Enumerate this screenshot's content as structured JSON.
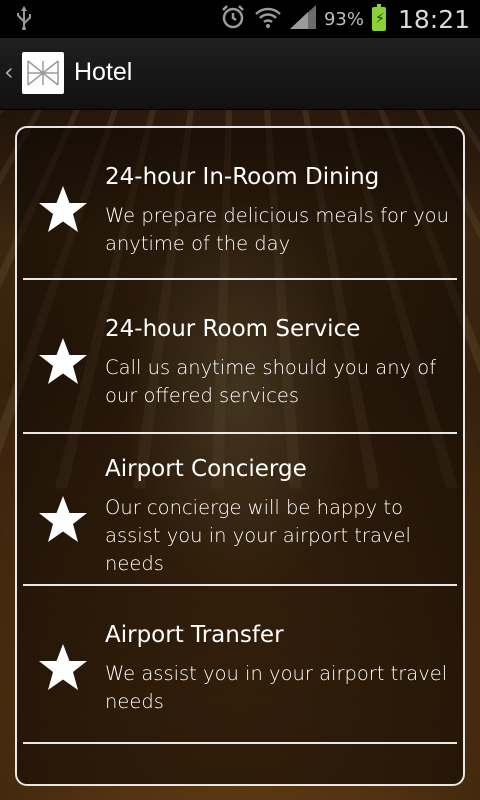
{
  "status_bar": {
    "battery_percent": "93%",
    "time": "18:21",
    "icons": [
      "usb-icon",
      "alarm-icon",
      "wifi-icon",
      "signal-icon",
      "battery-charging-icon"
    ]
  },
  "action_bar": {
    "title": "Hotel",
    "logo": "hotel-logo-icon"
  },
  "services": [
    {
      "title": "24-hour In-Room Dining",
      "description": "We prepare delicious meals for you anytime of the day",
      "icon": "star-icon"
    },
    {
      "title": "24-hour Room Service",
      "description": "Call us anytime should you any of our offered services",
      "icon": "star-icon"
    },
    {
      "title": "Airport Concierge",
      "description": "Our concierge will be happy to assist you in your airport travel needs",
      "icon": "star-icon"
    },
    {
      "title": "Airport Transfer",
      "description": "We assist you in your airport travel needs",
      "icon": "star-icon"
    }
  ]
}
